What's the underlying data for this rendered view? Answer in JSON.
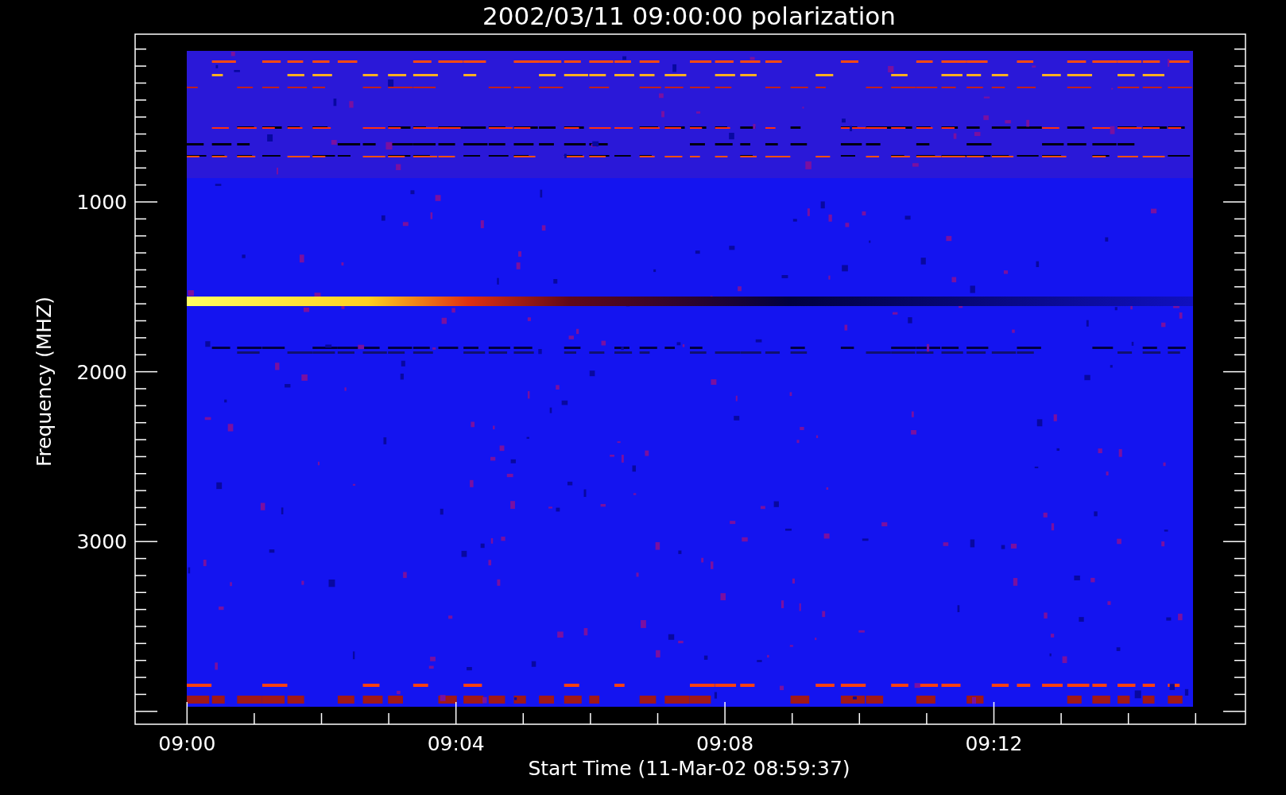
{
  "title": "2002/03/11 09:00:00 polarization",
  "y_axis": {
    "label": "Frequency (MHZ)",
    "tick_labels": [
      "1000",
      "2000",
      "3000"
    ]
  },
  "x_axis": {
    "label": "Start Time (11-Mar-02 08:59:37)",
    "tick_labels": [
      "09:00",
      "09:04",
      "09:08",
      "09:12"
    ]
  }
}
